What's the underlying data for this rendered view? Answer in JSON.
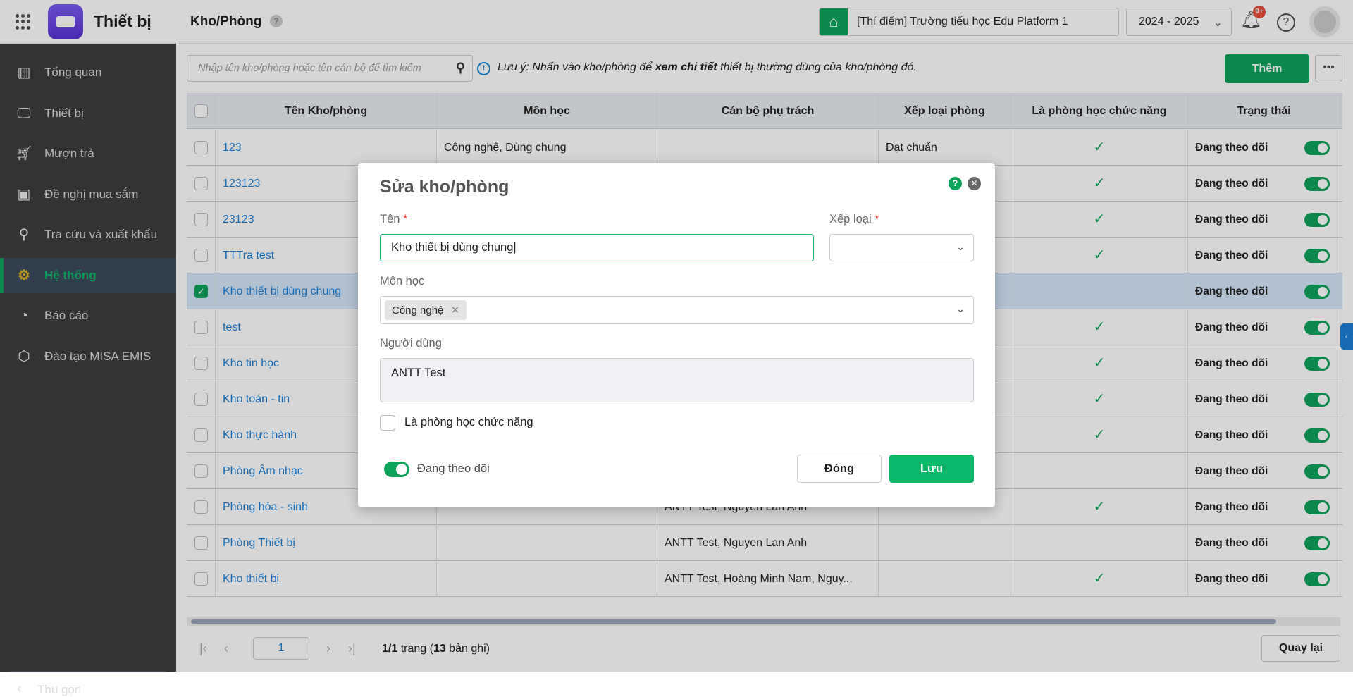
{
  "header": {
    "app_title": "Thiết bị",
    "page_title": "Kho/Phòng",
    "help_glyph": "?",
    "school": "[Thí điểm] Trường tiểu học Edu Platform 1",
    "school_year": "2024 - 2025",
    "notifications_badge": "9+"
  },
  "sidebar": {
    "items": [
      {
        "label": "Tổng quan",
        "icon": "chart-icon"
      },
      {
        "label": "Thiết bị",
        "icon": "monitor-icon"
      },
      {
        "label": "Mượn trả",
        "icon": "cart-icon"
      },
      {
        "label": "Đề nghị mua sắm",
        "icon": "projector-icon"
      },
      {
        "label": "Tra cứu và xuất khẩu",
        "icon": "search-icon"
      },
      {
        "label": "Hệ thống",
        "icon": "gear-icon",
        "active": true
      },
      {
        "label": "Báo cáo",
        "icon": "pie-icon"
      },
      {
        "label": "Đào tạo MISA EMIS",
        "icon": "box-icon"
      }
    ],
    "collapse_label": "Thu gọn"
  },
  "toolbar": {
    "search_placeholder": "Nhập tên kho/phòng hoặc tên cán bộ để tìm kiếm",
    "note_prefix": "Lưu ý: Nhấn vào kho/phòng để ",
    "note_bold": "xem chi tiết",
    "note_suffix": " thiết bị thường dùng của kho/phòng đó.",
    "add_label": "Thêm",
    "more_label": "•••"
  },
  "table": {
    "columns": [
      "Tên Kho/phòng",
      "Môn học",
      "Cán bộ phụ trách",
      "Xếp loại phòng",
      "Là phòng học chức năng",
      "Trạng thái"
    ],
    "rows": [
      {
        "name": "123",
        "subjects": "Công nghệ, Dùng chung",
        "staff": "",
        "rank": "Đạt chuẩn",
        "functional": true,
        "status": "Đang theo dõi",
        "checked": false
      },
      {
        "name": "123123",
        "subjects": "",
        "staff": "",
        "rank": "",
        "functional": true,
        "status": "Đang theo dõi",
        "checked": false
      },
      {
        "name": "23123",
        "subjects": "",
        "staff": "",
        "rank": "",
        "functional": true,
        "status": "Đang theo dõi",
        "checked": false
      },
      {
        "name": "TTTra test",
        "subjects": "",
        "staff": "",
        "rank": "",
        "functional": true,
        "status": "Đang theo dõi",
        "checked": false
      },
      {
        "name": "Kho thiết bị dùng chung",
        "subjects": "",
        "staff": "",
        "rank": "",
        "functional": false,
        "status": "Đang theo dõi",
        "checked": true
      },
      {
        "name": "test",
        "subjects": "",
        "staff": "",
        "rank": "",
        "functional": true,
        "status": "Đang theo dõi",
        "checked": false
      },
      {
        "name": "Kho tin học",
        "subjects": "",
        "staff": "",
        "rank": "",
        "functional": true,
        "status": "Đang theo dõi",
        "checked": false
      },
      {
        "name": "Kho toán - tin",
        "subjects": "",
        "staff": "",
        "rank": "",
        "functional": true,
        "status": "Đang theo dõi",
        "checked": false
      },
      {
        "name": "Kho thực hành",
        "subjects": "",
        "staff": "",
        "rank": "",
        "functional": true,
        "status": "Đang theo dõi",
        "checked": false
      },
      {
        "name": "Phòng Âm nhạc",
        "subjects": "",
        "staff": "",
        "rank": "",
        "functional": false,
        "status": "Đang theo dõi",
        "checked": false
      },
      {
        "name": "Phòng hóa - sinh",
        "subjects": "",
        "staff": "ANTT Test, Nguyen Lan Anh",
        "rank": "",
        "functional": true,
        "status": "Đang theo dõi",
        "checked": false
      },
      {
        "name": "Phòng Thiết bị",
        "subjects": "",
        "staff": "ANTT Test, Nguyen Lan Anh",
        "rank": "",
        "functional": false,
        "status": "Đang theo dõi",
        "checked": false
      },
      {
        "name": "Kho thiết bị",
        "subjects": "",
        "staff": "ANTT Test, Hoàng Minh Nam, Nguy...",
        "rank": "",
        "functional": true,
        "status": "Đang theo dõi",
        "checked": false
      }
    ]
  },
  "pagination": {
    "page": "1",
    "page_info_bold": "1/1",
    "page_info_mid": " trang (",
    "count_bold": "13",
    "page_info_end": " bản ghi)",
    "back_label": "Quay lại"
  },
  "modal": {
    "title": "Sửa kho/phòng",
    "name_label": "Tên",
    "required": "*",
    "name_value": "Kho thiết bị dùng chung",
    "rank_label": "Xếp loại",
    "rank_value": "",
    "subject_label": "Môn học",
    "subject_chip": "Công nghệ",
    "users_label": "Người dùng",
    "users_value": "ANTT Test",
    "functional_label": "Là phòng học chức năng",
    "functional_checked": false,
    "tracking_label": "Đang theo dõi",
    "tracking_on": true,
    "close_label": "Đóng",
    "save_label": "Lưu"
  },
  "colors": {
    "accent": "#0ea35a",
    "link": "#1a7fd6"
  }
}
